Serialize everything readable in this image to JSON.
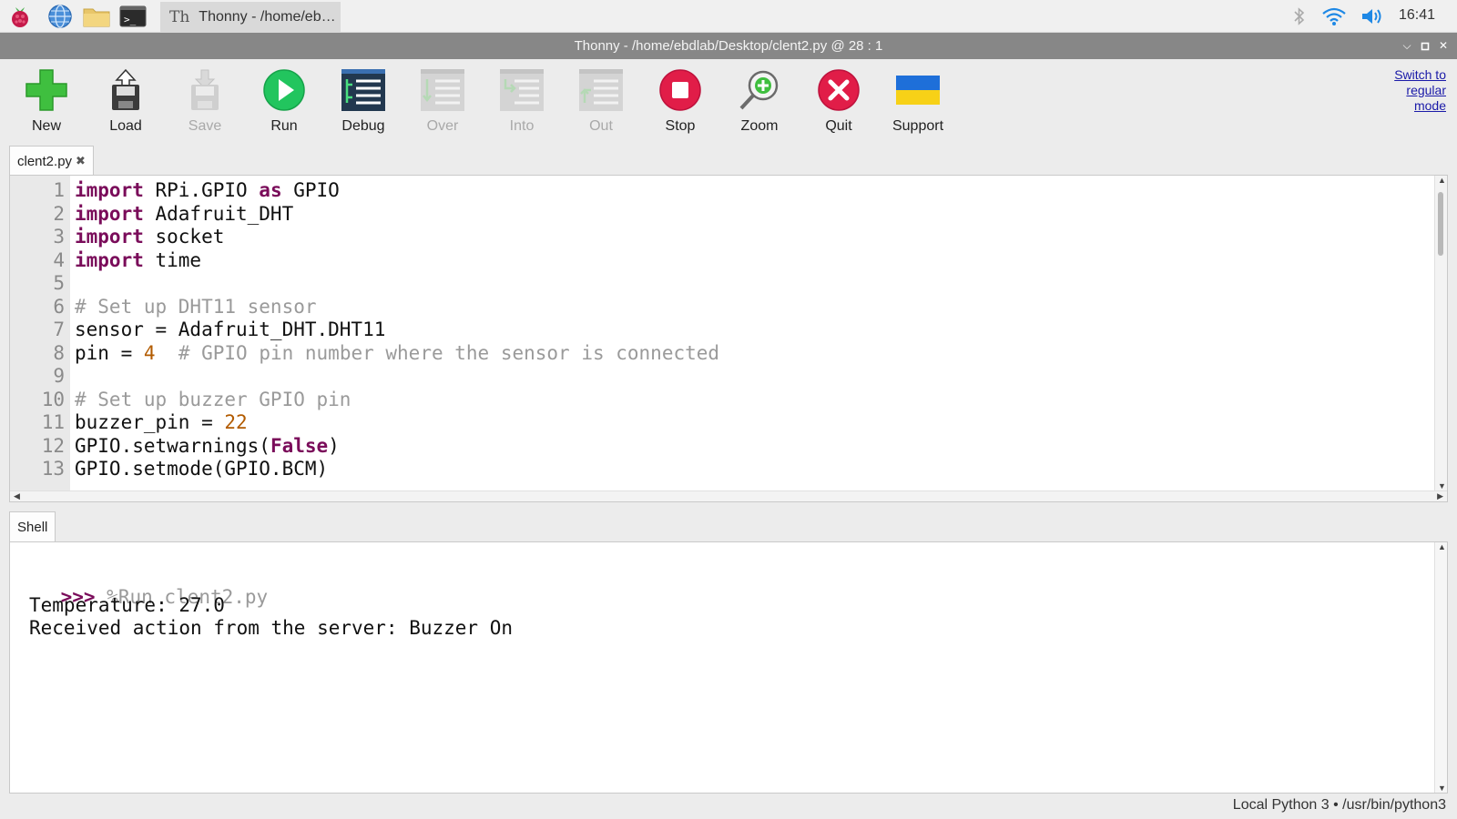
{
  "taskbar": {
    "launchers": [
      {
        "name": "raspberry-menu",
        "icon": "raspberry-icon"
      },
      {
        "name": "web-browser",
        "icon": "globe-icon"
      },
      {
        "name": "file-manager",
        "icon": "folder-icon"
      },
      {
        "name": "terminal",
        "icon": "terminal-icon"
      }
    ],
    "task_label": "Thonny  -  /home/eb…",
    "clock": "16:41",
    "tray_icons": [
      "bluetooth-icon",
      "wifi-icon",
      "volume-icon"
    ]
  },
  "window": {
    "title": "Thonny  -  /home/ebdlab/Desktop/clent2.py  @  28 : 1"
  },
  "toolbar": {
    "buttons": [
      {
        "id": "new",
        "label": "New",
        "icon": "new-file-icon",
        "enabled": true
      },
      {
        "id": "load",
        "label": "Load",
        "icon": "load-icon",
        "enabled": true
      },
      {
        "id": "save",
        "label": "Save",
        "icon": "save-icon",
        "enabled": false
      },
      {
        "id": "run",
        "label": "Run",
        "icon": "run-icon",
        "enabled": true
      },
      {
        "id": "debug",
        "label": "Debug",
        "icon": "debug-icon",
        "enabled": true
      },
      {
        "id": "over",
        "label": "Over",
        "icon": "step-over-icon",
        "enabled": false
      },
      {
        "id": "into",
        "label": "Into",
        "icon": "step-into-icon",
        "enabled": false
      },
      {
        "id": "out",
        "label": "Out",
        "icon": "step-out-icon",
        "enabled": false
      },
      {
        "id": "stop",
        "label": "Stop",
        "icon": "stop-icon",
        "enabled": true
      },
      {
        "id": "zoom",
        "label": "Zoom",
        "icon": "zoom-icon",
        "enabled": true
      },
      {
        "id": "quit",
        "label": "Quit",
        "icon": "quit-icon",
        "enabled": true
      },
      {
        "id": "support",
        "label": "Support",
        "icon": "ukraine-flag-icon",
        "enabled": true
      }
    ],
    "switch_mode_lines": [
      "Switch to",
      "regular",
      "mode"
    ]
  },
  "editor": {
    "tab_label": "clent2.py",
    "lines": [
      {
        "n": "1",
        "tokens": [
          {
            "t": "kw",
            "v": "import"
          },
          {
            "t": "tx",
            "v": " RPi.GPIO "
          },
          {
            "t": "kw",
            "v": "as"
          },
          {
            "t": "tx",
            "v": " GPIO"
          }
        ]
      },
      {
        "n": "2",
        "tokens": [
          {
            "t": "kw",
            "v": "import"
          },
          {
            "t": "tx",
            "v": " Adafruit_DHT"
          }
        ]
      },
      {
        "n": "3",
        "tokens": [
          {
            "t": "kw",
            "v": "import"
          },
          {
            "t": "tx",
            "v": " socket"
          }
        ]
      },
      {
        "n": "4",
        "tokens": [
          {
            "t": "kw",
            "v": "import"
          },
          {
            "t": "tx",
            "v": " time"
          }
        ]
      },
      {
        "n": "5",
        "tokens": []
      },
      {
        "n": "6",
        "tokens": [
          {
            "t": "cm",
            "v": "# Set up DHT11 sensor"
          }
        ]
      },
      {
        "n": "7",
        "tokens": [
          {
            "t": "tx",
            "v": "sensor = Adafruit_DHT.DHT11"
          }
        ]
      },
      {
        "n": "8",
        "tokens": [
          {
            "t": "tx",
            "v": "pin = "
          },
          {
            "t": "nm",
            "v": "4"
          },
          {
            "t": "tx",
            "v": "  "
          },
          {
            "t": "cm",
            "v": "# GPIO pin number where the sensor is connected"
          }
        ]
      },
      {
        "n": "9",
        "tokens": []
      },
      {
        "n": "10",
        "tokens": [
          {
            "t": "cm",
            "v": "# Set up buzzer GPIO pin"
          }
        ]
      },
      {
        "n": "11",
        "tokens": [
          {
            "t": "tx",
            "v": "buzzer_pin = "
          },
          {
            "t": "nm",
            "v": "22"
          }
        ]
      },
      {
        "n": "12",
        "tokens": [
          {
            "t": "tx",
            "v": "GPIO.setwarnings("
          },
          {
            "t": "kw",
            "v": "False"
          },
          {
            "t": "tx",
            "v": ")"
          }
        ]
      },
      {
        "n": "13",
        "tokens": [
          {
            "t": "tx",
            "v": "GPIO.setmode(GPIO.BCM)"
          }
        ]
      }
    ]
  },
  "shell": {
    "tab_label": "Shell",
    "prompt": ">>>",
    "command": "%Run clent2.py",
    "output": [
      "Temperature: 27.0",
      "Received action from the server: Buzzer On"
    ]
  },
  "status": {
    "interpreter": "Local Python 3  •  /usr/bin/python3"
  },
  "colors": {
    "keyword": "#7a0c5a",
    "comment": "#9a9a9a",
    "number": "#b25b00",
    "titlebar": "#878787"
  }
}
